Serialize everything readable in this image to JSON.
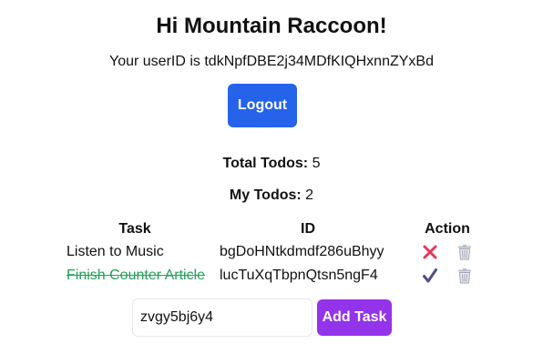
{
  "greeting": "Hi Mountain Raccoon!",
  "user": {
    "id_prefix": "Your userID is ",
    "id": "tdkNpfDBE2j34MDfKIQHxnnZYxBd"
  },
  "logout_label": "Logout",
  "stats": {
    "total_label": "Total Todos:",
    "total_value": "5",
    "mine_label": "My Todos:",
    "mine_value": "2"
  },
  "table": {
    "headers": {
      "task": "Task",
      "id": "ID",
      "action": "Action"
    },
    "rows": [
      {
        "task": "Listen to Music",
        "id": "bgDoHNtkdmdf286uBhyy",
        "completed": false,
        "toggle_icon": "cross-icon",
        "delete_icon": "trash-icon"
      },
      {
        "task": "Finish Counter Article",
        "id": "lucTuXqTbpnQtsn5ngF4",
        "completed": true,
        "toggle_icon": "check-icon",
        "delete_icon": "trash-icon"
      }
    ]
  },
  "new_todo": {
    "value": "zvgy5bj6y4",
    "button_label": "Add Task"
  },
  "colors": {
    "logout_button": "#2563eb",
    "add_button": "#9333ea",
    "completed_task": "#22a05a",
    "cross_icon": "#e8375a",
    "check_icon": "#5b4a8b",
    "trash_icon": "#9ca3af"
  }
}
